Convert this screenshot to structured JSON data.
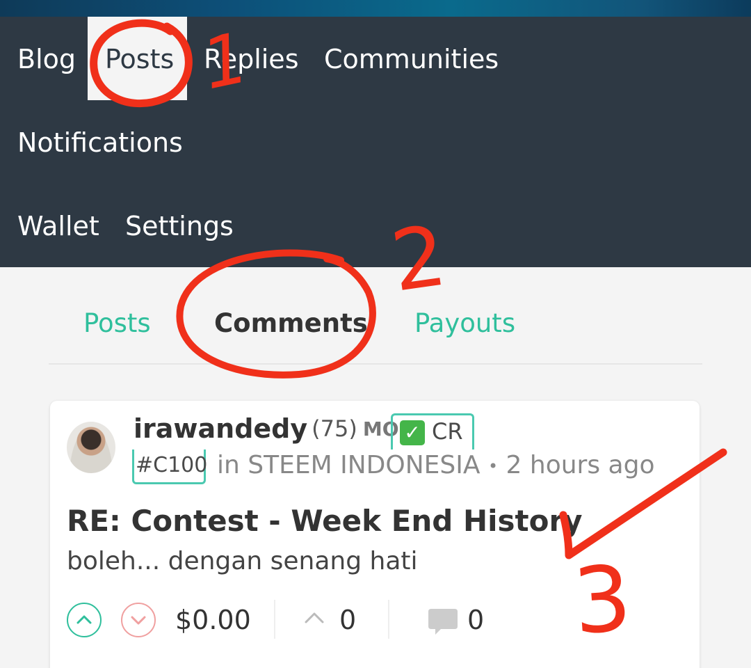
{
  "profile_nav": {
    "items": [
      {
        "label": "Blog"
      },
      {
        "label": "Posts",
        "active": true
      },
      {
        "label": "Replies"
      },
      {
        "label": "Communities"
      },
      {
        "label": "Notifications"
      },
      {
        "label": "Wallet"
      },
      {
        "label": "Settings"
      }
    ]
  },
  "sub_tabs": [
    {
      "label": "Posts"
    },
    {
      "label": "Comments",
      "active": true
    },
    {
      "label": "Payouts"
    }
  ],
  "post": {
    "author": "irawandedy",
    "reputation": "(75)",
    "role": "MOD",
    "badge_text": "CR",
    "badge_tag": "#C100",
    "community": "in STEEM INDONESIA",
    "separator": "•",
    "time": "2 hours ago",
    "title": "RE: Contest - Week End History",
    "body": "boleh... dengan senang hati",
    "payout": "$0.00",
    "resteems": "0",
    "comments": "0"
  },
  "annotations": {
    "marks": [
      "1",
      "2",
      "3"
    ],
    "color": "#f0301a"
  },
  "colors": {
    "nav_bg": "#2e3944",
    "accent": "#2fbf9c",
    "downvote": "#f0a0a0",
    "badge_border": "#4ac9b0"
  }
}
